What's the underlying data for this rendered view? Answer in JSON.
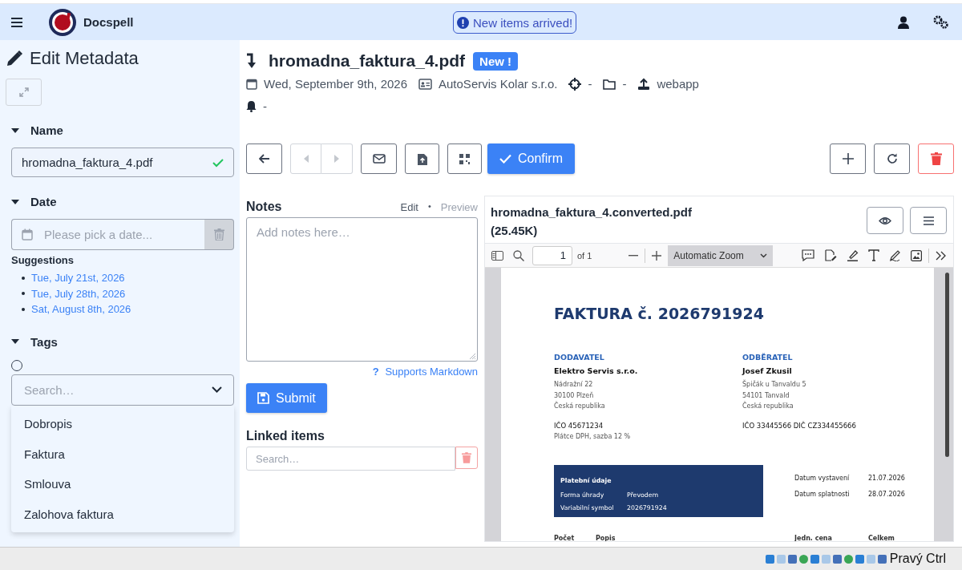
{
  "topbar": {
    "app_name": "Docspell",
    "notice": "New items arrived!"
  },
  "sidebar": {
    "title": "Edit Metadata",
    "name_section": {
      "label": "Name",
      "expanded": true,
      "value": "hromadna_faktura_4.pdf"
    },
    "date_section": {
      "label": "Date",
      "expanded": true,
      "placeholder": "Please pick a date...",
      "suggestions_label": "Suggestions",
      "suggestions": [
        "Tue, July 21st, 2026",
        "Tue, July 28th, 2026",
        "Sat, August 8th, 2026"
      ]
    },
    "tags_section": {
      "label": "Tags",
      "expanded": true,
      "radio_checked": false,
      "search_placeholder": "Search…",
      "options": [
        "Dobropis",
        "Faktura",
        "Smlouva",
        "Zalohova faktura"
      ]
    }
  },
  "item": {
    "title": "hromadna_faktura_4.pdf",
    "badge": "New !",
    "meta": [
      {
        "kind": "date",
        "text": "Wed, September 9th, 2026"
      },
      {
        "kind": "correspondent",
        "text": "AutoServis Kolar s.r.o."
      },
      {
        "kind": "concerning",
        "text": "-"
      },
      {
        "kind": "folder",
        "text": "-"
      },
      {
        "kind": "source",
        "text": "webapp"
      }
    ],
    "due": "-"
  },
  "toolbar": {
    "confirm": "Confirm"
  },
  "notes": {
    "title": "Notes",
    "modes": [
      {
        "label": "Edit",
        "selected": true
      },
      {
        "label": "Preview",
        "selected": false
      }
    ],
    "separator": "•",
    "placeholder": "Add notes here…",
    "help_icon": "?",
    "help": "Supports Markdown",
    "submit": "Submit"
  },
  "linked": {
    "title": "Linked items",
    "placeholder": "Search…"
  },
  "viewer": {
    "title": "hromadna_faktura_4.converted.pdf (25.45K)",
    "page": "1",
    "page_count": "of 1",
    "zoom": "Automatic Zoom",
    "document": {
      "heading": "FAKTURA č. 2026791924",
      "supplier": {
        "label": "DODAVATEL",
        "name": "Elektro Servis s.r.o.",
        "lines": [
          "Nádražní 22",
          "30100 Plzeň",
          "Česká republika"
        ],
        "ids": "IČO 45671234",
        "note": "Plátce DPH, sazba 12 %"
      },
      "customer": {
        "label": "ODBĚRATEL",
        "name": "Josef Zkusil",
        "lines": [
          "Špičák u Tanvaldu 5",
          "54101 Tanvald",
          "Česká republika"
        ],
        "ids": "IČO 33445566  DIČ CZ334455666"
      },
      "payment": {
        "title": "Platební údaje",
        "rows": [
          {
            "label": "Forma úhrady",
            "value": "Převodem"
          },
          {
            "label": "Variabilní symbol",
            "value": "2026791924"
          }
        ]
      },
      "dates": [
        {
          "label": "Datum vystavení",
          "value": "21.07.2026"
        },
        {
          "label": "Datum splatnosti",
          "value": "28.07.2026"
        }
      ],
      "table_headers": [
        "Počet",
        "Popis",
        "Jedn. cena",
        "Celkem"
      ]
    }
  },
  "host_bar": {
    "label": "Pravý Ctrl"
  }
}
